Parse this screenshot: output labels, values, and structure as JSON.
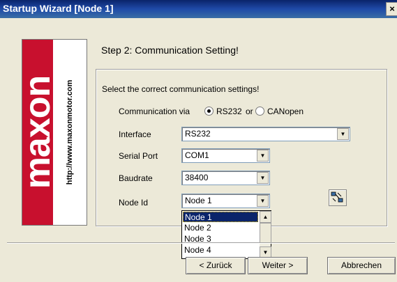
{
  "window": {
    "title": "Startup Wizard  [Node 1]",
    "close_label": "×"
  },
  "logo": {
    "brand": "maxon",
    "url": "http://www.maxonmotor.com"
  },
  "step_title": "Step 2: Communication Setting!",
  "instructions": "Select the correct communication settings!",
  "communication": {
    "label": "Communication via",
    "options": [
      {
        "label": "RS232",
        "selected": true
      },
      {
        "label": "CANopen",
        "selected": false
      }
    ],
    "or_label": "or"
  },
  "fields": {
    "interface": {
      "label": "Interface",
      "value": "RS232"
    },
    "serial_port": {
      "label": "Serial Port",
      "value": "COM1"
    },
    "baudrate": {
      "label": "Baudrate",
      "value": "38400"
    },
    "node_id": {
      "label": "Node Id",
      "value": "Node 1"
    }
  },
  "node_dropdown": {
    "items": [
      "Node 1",
      "Node 2",
      "Node 3",
      "Node 4"
    ],
    "selected_index": 0
  },
  "buttons": {
    "back": "< Zurück",
    "next": "Weiter >",
    "cancel": "Abbrechen"
  },
  "icons": {
    "search_nodes": "node-search-icon"
  }
}
